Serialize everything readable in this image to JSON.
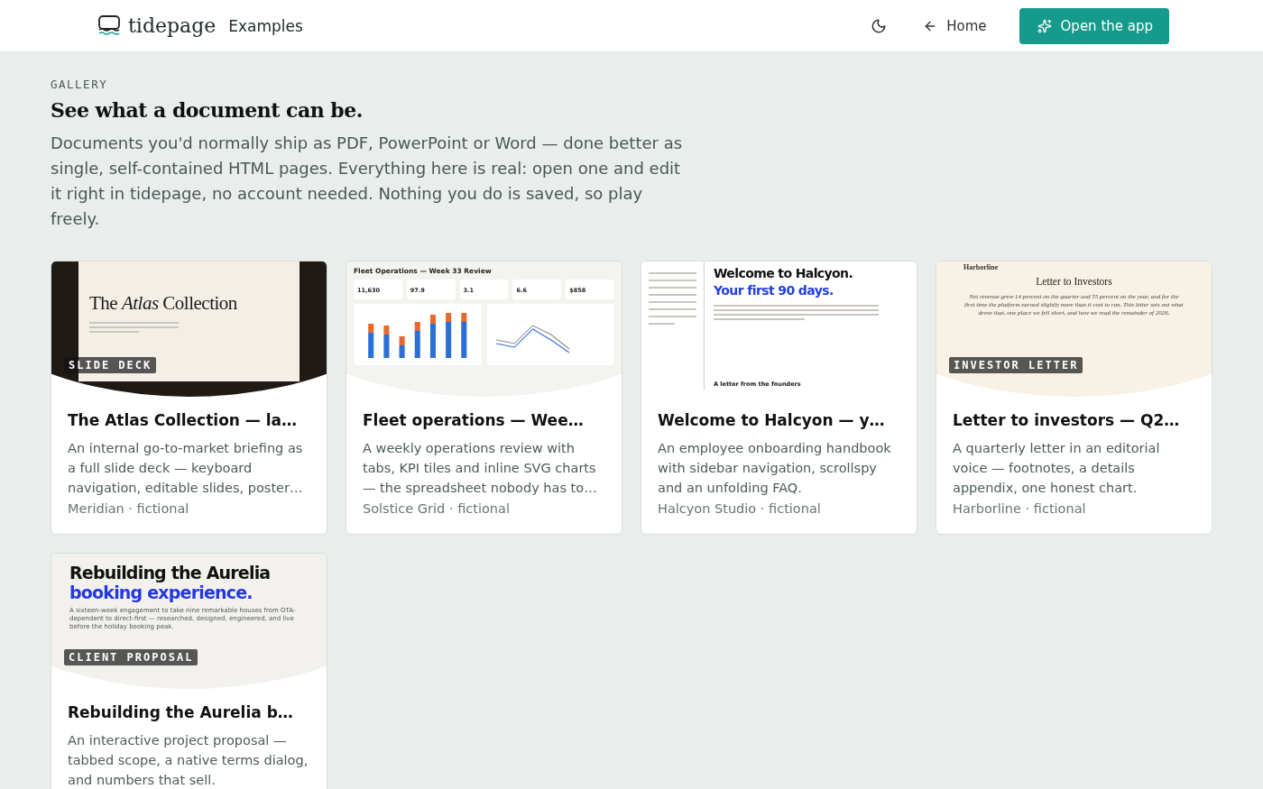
{
  "header": {
    "logo": "tidepage",
    "section": "Examples",
    "nav": [
      {
        "kind": "theme"
      },
      {
        "kind": "link",
        "label": "Home"
      },
      {
        "kind": "primary",
        "label": "Open the app"
      }
    ]
  },
  "intro": {
    "eyebrow": "GALLERY",
    "title": "See what a document can be.",
    "text": "Documents you'd normally ship as PDF, PowerPoint or Word — done better as single, self-contained HTML pages. Everything here is real: open one and edit it right in tidepage, no account needed. Nothing you do is saved, so play freely."
  },
  "cards": [
    {
      "kind": "deck",
      "tag": "SLIDE DECK",
      "preview": {
        "headline": "The *Atlas* Collection"
      },
      "title": "The Atlas Collection — la…",
      "description": "An internal go-to-market briefing as a full slide deck — keyboard navigation, editable slides, poster…",
      "meta": "Meridian · fictional"
    },
    {
      "kind": "dashboard",
      "preview": {
        "headline": "Fleet Operations — Week 33 Review",
        "kpis": [
          "11,630",
          "97.9",
          "3.1",
          "6.6",
          "$858"
        ]
      },
      "title": "Fleet operations — Wee…",
      "description": "A weekly operations review with tabs, KPI tiles and inline SVG charts — the spreadsheet nobody has to…",
      "meta": "Solstice Grid · fictional"
    },
    {
      "kind": "handbook",
      "preview": {
        "headline": "Welcome to Halcyon.",
        "subhead": "Your first 90 days.",
        "section": "A letter from the founders"
      },
      "title": "Welcome to Halcyon — y…",
      "description": "An employee onboarding handbook with sidebar navigation, scrollspy and an unfolding FAQ.",
      "meta": "Halcyon Studio · fictional"
    },
    {
      "kind": "letter",
      "tag": "INVESTOR LETTER",
      "preview": {
        "brand": "Harborline",
        "headline": "Letter to Investors",
        "body": "Net revenue grew 14 percent on the quarter and 55 percent on the year, and for the first time the platform earned slightly more than it cost to run. This letter sets out what drove that, one place we fell short, and how we read the remainder of 2026."
      },
      "title": "Letter to investors — Q2…",
      "description": "A quarterly letter in an editorial voice — footnotes, a details appendix, one honest chart.",
      "meta": "Harborline · fictional"
    },
    {
      "kind": "proposal",
      "tag": "CLIENT PROPOSAL",
      "preview": {
        "headline": "Rebuilding the Aurelia",
        "subhead": "booking experience.",
        "body": "A sixteen-week engagement to take nine remarkable houses from OTA-dependent to direct-first — researched, designed, engineered, and live before the holiday booking peak."
      },
      "title": "Rebuilding the Aurelia b…",
      "description": "An interactive project proposal — tabbed scope, a native terms dialog, and numbers that sell."
    }
  ]
}
